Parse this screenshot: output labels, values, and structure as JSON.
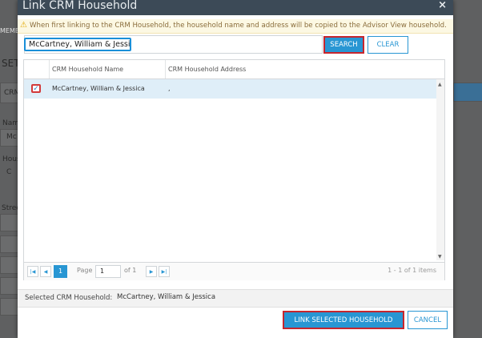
{
  "background": {
    "fragments": [
      "MEMBE",
      "SET",
      "CRM",
      "Nam",
      "Mc",
      "Hous",
      "C",
      "Stree"
    ]
  },
  "dialog": {
    "title": "Link CRM Household",
    "close_glyph": "×",
    "warning_icon": "⚠",
    "warning_text": "When first linking to the CRM Household, the household name and address will be copied to the Advisor View household."
  },
  "search": {
    "value": "McCartney, William & Jessica",
    "search_label": "SEARCH",
    "clear_label": "CLEAR"
  },
  "grid": {
    "columns": [
      "CRM Household Name",
      "CRM Household Address"
    ],
    "rows": [
      {
        "checked_glyph": "✓",
        "name": "McCartney, William & Jessica",
        "address": ","
      }
    ],
    "scroll_up_glyph": "▲",
    "scroll_down_glyph": "▼"
  },
  "pager": {
    "first_glyph": "|◀",
    "prev_glyph": "◀",
    "current_page": "1",
    "page_label": "Page",
    "page_input": "1",
    "of_label": "of 1",
    "next_glyph": "▶",
    "last_glyph": "▶|",
    "info": "1 - 1 of 1 items"
  },
  "selection": {
    "label": "Selected CRM Household:",
    "value": "McCartney, William & Jessica"
  },
  "footer": {
    "link_label": "LINK SELECTED HOUSEHOLD",
    "cancel_label": "CANCEL"
  },
  "colors": {
    "accent": "#2896d3",
    "highlight_border": "#c6262e",
    "header_bg": "#3c4a57",
    "warning_bg": "#fcf8e3",
    "selected_row": "#dfeef8"
  }
}
